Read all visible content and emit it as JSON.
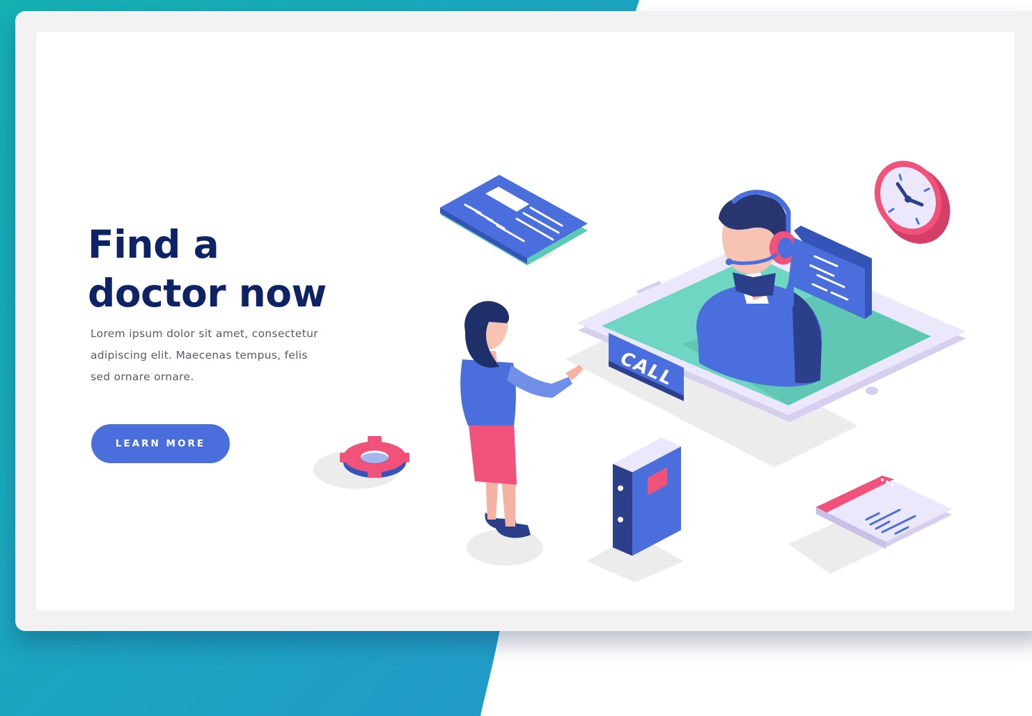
{
  "hero": {
    "title_line1": "Find a",
    "title_line2": "doctor now",
    "body_line1": "Lorem ipsum dolor sit amet, consectetur",
    "body_line2": "adipiscing elit. Maecenas tempus, felis",
    "body_line3": "sed ornare ornare.",
    "cta_label": "LEARN MORE"
  },
  "illustration": {
    "call_label": "CALL",
    "icons": [
      "brochure-icon",
      "clock-icon",
      "headset-operator",
      "chat-bubble-icon",
      "tablet-device",
      "gear-icon",
      "binder-icon",
      "browser-window-icon",
      "woman-figure"
    ]
  },
  "colors": {
    "background_teal": "#18a9b8",
    "background_blue": "#2196c9",
    "title_navy": "#0d2366",
    "accent_blue": "#4a6fdc",
    "accent_pink": "#f0527a",
    "accent_green": "#6fd6c2",
    "lavender": "#e4e0f5"
  }
}
